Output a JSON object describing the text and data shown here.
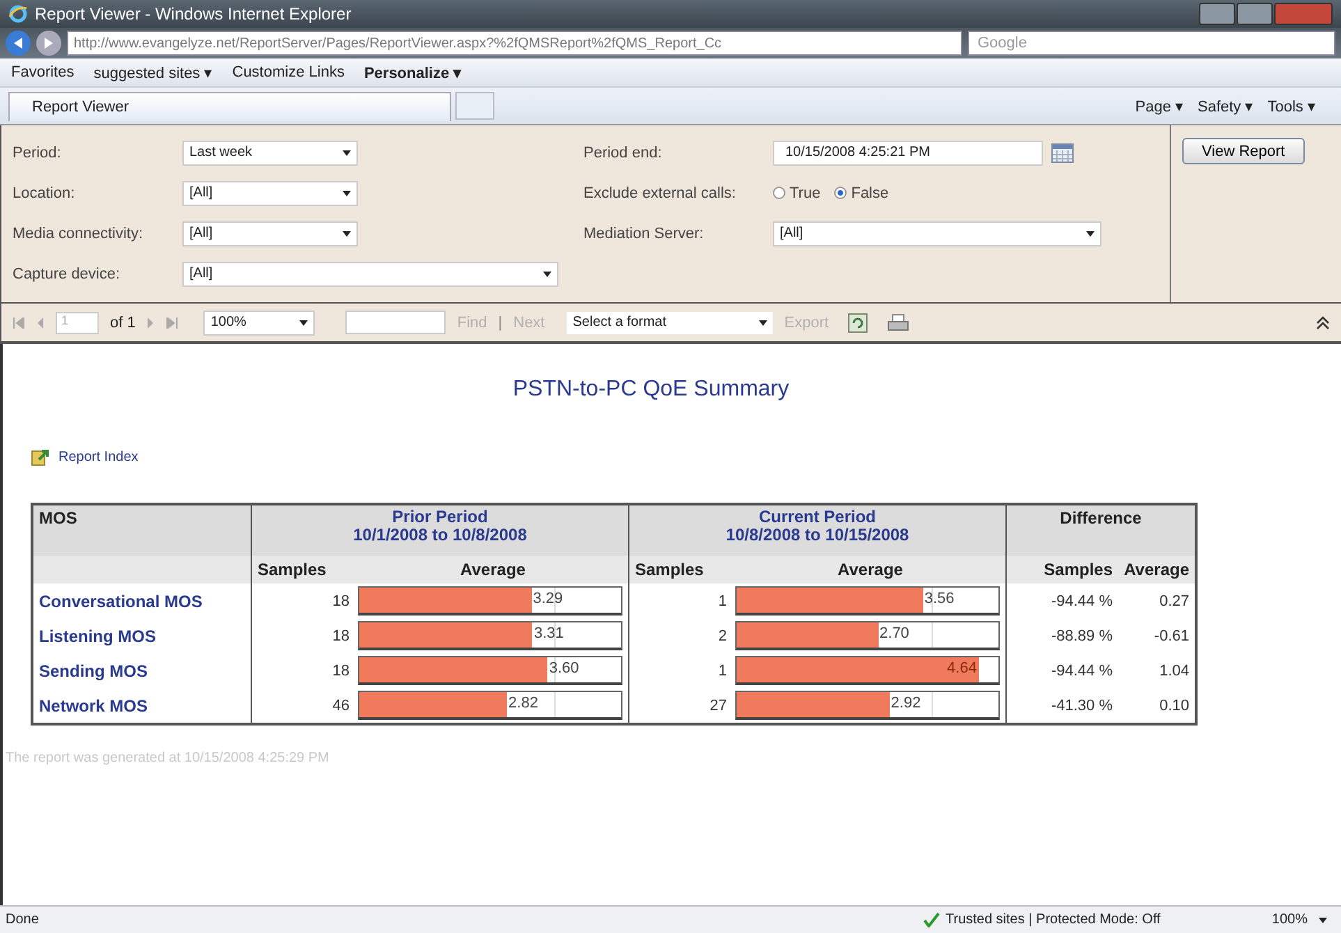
{
  "window": {
    "title": "Report Viewer - Windows Internet Explorer"
  },
  "address_bar": {
    "url": "http://www.evangelyze.net/ReportServer/Pages/ReportViewer.aspx?%2fQMSReport%2fQMS_Report_Cc",
    "search_placeholder": "Google"
  },
  "favorites_bar": [
    "Favorites",
    "suggested sites ▾",
    "Customize Links",
    "Personalize ▾"
  ],
  "tab": {
    "title": "Report Viewer"
  },
  "command_bar": [
    "Page ▾",
    "Safety ▾",
    "Tools ▾"
  ],
  "parameters_left": [
    {
      "label": "Period:",
      "kind": "dropdown",
      "value": "Last week"
    },
    {
      "label": "Location:",
      "kind": "dropdown",
      "value": "[All]"
    },
    {
      "label": "Media connectivity:",
      "kind": "dropdown",
      "value": "[All]"
    },
    {
      "label": "Capture device:",
      "kind": "wide_dropdown",
      "value": "[All]"
    }
  ],
  "parameters_right": [
    {
      "label": "Period end:",
      "kind": "date",
      "value": "10/15/2008 4:25:21 PM"
    },
    {
      "label": "Exclude external calls:",
      "kind": "radio",
      "options": [
        {
          "label": "True",
          "selected": false
        },
        {
          "label": "False",
          "selected": true
        }
      ]
    },
    {
      "label": "Mediation Server:",
      "kind": "dropdown",
      "value": "[All]"
    }
  ],
  "view_report_button": "View Report",
  "toolbar": {
    "page": "1",
    "of_pages": "of 1",
    "zoom": "100%",
    "find": "Find",
    "separator": "|",
    "next": "Next",
    "format": "Select a format",
    "export": "Export"
  },
  "report": {
    "title": "PSTN-to-PC QoE Summary",
    "index_link": "Report Index",
    "table": {
      "first_header": "MOS",
      "groups": [
        {
          "title": "Prior Period",
          "range": "10/1/2008 to 10/8/2008",
          "samples": "Samples",
          "average": "Average"
        },
        {
          "title": "Current Period",
          "range": "10/8/2008 to 10/15/2008",
          "samples": "Samples",
          "average": "Average"
        }
      ],
      "difference": {
        "title": "Difference",
        "samples": "Samples",
        "average": "Average"
      },
      "rows": [
        {
          "name": "Conversational MOS",
          "prior": {
            "samples": "18",
            "average": "3.29",
            "level": 0.658
          },
          "current": {
            "samples": "1",
            "average": "3.56",
            "level": 0.712
          },
          "diff_samples": "-94.44 %",
          "diff_average": "0.27"
        },
        {
          "name": "Listening MOS",
          "prior": {
            "samples": "18",
            "average": "3.31",
            "level": 0.662
          },
          "current": {
            "samples": "2",
            "average": "2.70",
            "level": 0.54
          },
          "diff_samples": "-88.89 %",
          "diff_average": "-0.61"
        },
        {
          "name": "Sending MOS",
          "prior": {
            "samples": "18",
            "average": "3.60",
            "level": 0.72
          },
          "current": {
            "samples": "1",
            "average": "4.64",
            "level": 0.928
          },
          "diff_samples": "-94.44 %",
          "diff_average": "1.04"
        },
        {
          "name": "Network MOS",
          "prior": {
            "samples": "46",
            "average": "2.82",
            "level": 0.564
          },
          "current": {
            "samples": "27",
            "average": "2.92",
            "level": 0.584
          },
          "diff_samples": "-41.30 %",
          "diff_average": "0.10"
        }
      ]
    },
    "generated": "The report was generated at 10/15/2008 4:25:29 PM"
  },
  "status_bar": {
    "text": "Done",
    "zone": "Trusted sites | Protected Mode: Off",
    "zoom": "100%"
  }
}
